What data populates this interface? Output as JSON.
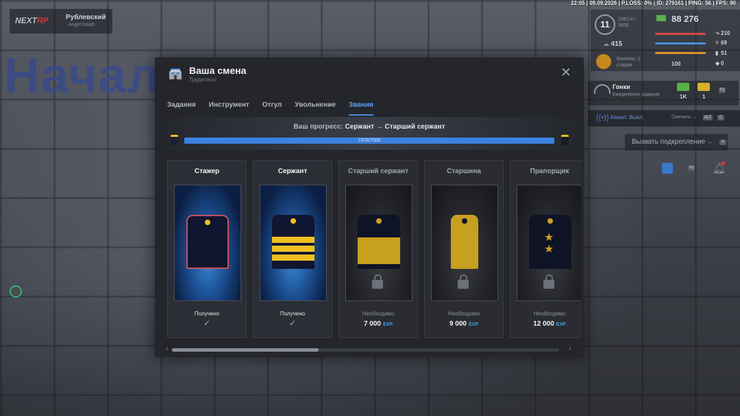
{
  "background": {
    "word": "Начал"
  },
  "topbar": {
    "text": "22:05 | 09.09.2026 | P.LOSS: 0% | ID: 279161 | PING: 56 | FPS: 90"
  },
  "logo": {
    "text_a": "NEXT",
    "text_b": "RP",
    "location": "Рублевский",
    "sub": "Angel Death"
  },
  "hud": {
    "level": "11",
    "level_text": "298/14 / 5600",
    "money": "88 276",
    "online": "415",
    "stats": [
      {
        "icon": "pulse-icon",
        "value": "210",
        "color": "#d84a4a"
      },
      {
        "icon": "fork-icon",
        "value": "69",
        "color": "#4a8de0"
      },
      {
        "icon": "drink-icon",
        "value": "51",
        "color": "#d8962a"
      },
      {
        "icon": "shield-icon",
        "value": "0",
        "color": "#8a8e98"
      }
    ],
    "sick_text": "Болезнь: 1 стадия",
    "sick_value": "100",
    "race_title": "Гонки",
    "race_sub": "Ежедневное задание",
    "rewards": [
      {
        "label": "1K",
        "color": "#5bb04a"
      },
      {
        "label": "1",
        "color": "#d8b02a"
      }
    ],
    "reward_key": "F2",
    "channel": "Канал: Выкл.",
    "channel_switch": "Сменить →",
    "channel_keys": [
      "ALT",
      "C"
    ],
    "backup_label": "Вызвать подкрепление",
    "backup_key": "X",
    "calendar_key": "F6"
  },
  "modal": {
    "title": "Ваша смена",
    "subtitle": "Трудитесь!",
    "tabs": [
      "Задания",
      "Инструмент",
      "Отгул",
      "Увольнение",
      "Звания"
    ],
    "active_tab": 4,
    "progress_label": "Ваш прогресс:",
    "progress_path": "Сержант → Старший сержант",
    "progress_text": "7478/7000",
    "progress_fraction": 1.0,
    "ranks": [
      {
        "name": "Стажер",
        "status": "Получено",
        "check": "✓",
        "state": "obtained"
      },
      {
        "name": "Сержант",
        "status": "Получено",
        "check": "✓",
        "state": "obtained"
      },
      {
        "name": "Старший сержант",
        "status": "Необходимо",
        "exp": "7 000",
        "exp_unit": "EXP",
        "state": "locked"
      },
      {
        "name": "Старшина",
        "status": "Необходимо",
        "exp": "9 000",
        "exp_unit": "EXP",
        "state": "locked"
      },
      {
        "name": "Прапорщик",
        "status": "Необходимо",
        "exp": "12 000",
        "exp_unit": "EXP",
        "state": "locked"
      }
    ],
    "scroll_left": "‹",
    "scroll_right": "›"
  }
}
